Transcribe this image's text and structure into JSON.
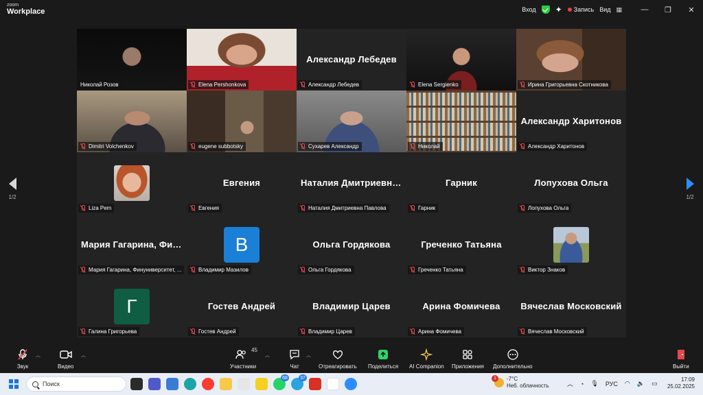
{
  "app": {
    "logo_top": "zoom",
    "logo_bottom": "Workplace"
  },
  "titlebar": {
    "enter": "Вход",
    "record": "Запись",
    "view": "Вид"
  },
  "colors": {
    "active_speaker": "#2ed36a",
    "accent": "#2d8cff",
    "muted": "#e5484d",
    "tile_bg": "#232323"
  },
  "gallery": {
    "page_indicator": "1/2",
    "tiles": [
      {
        "name": "Николай Розов",
        "kind": "video",
        "active": true,
        "muted": false,
        "scene": "dark"
      },
      {
        "name": "Elena Pershonkova",
        "kind": "video",
        "muted": true,
        "scene": "woman"
      },
      {
        "name": "Александр Лебедев",
        "display": "Александр Лебедев",
        "kind": "name",
        "muted": true
      },
      {
        "name": "Elena Sergienko",
        "kind": "video",
        "muted": true,
        "scene": "woman-dark"
      },
      {
        "name": "Ирина Григорьевна Скотникова",
        "kind": "video",
        "muted": true,
        "scene": "woman-room"
      },
      {
        "name": "Dimitri Volchenkov",
        "kind": "video",
        "muted": true,
        "scene": "man-headphones"
      },
      {
        "name": "eugene subbotsky",
        "kind": "video",
        "muted": true,
        "scene": "room-small"
      },
      {
        "name": "Сухарев Александр",
        "kind": "video",
        "muted": true,
        "scene": "man-bald"
      },
      {
        "name": "Николай",
        "kind": "video",
        "muted": true,
        "scene": "bookshelf"
      },
      {
        "name": "Александр Харитонов",
        "display": "Александр Харитонов",
        "kind": "name",
        "muted": true
      },
      {
        "name": "Liza Pem",
        "kind": "photo",
        "muted": true,
        "scene": "portrait-woman"
      },
      {
        "name": "Евгения",
        "display": "Евгения",
        "kind": "name",
        "muted": true
      },
      {
        "name": "Наталия Дмитриевна Павлова",
        "display": "Наталия Дмитриевна Павлова",
        "kind": "name",
        "muted": true
      },
      {
        "name": "Гарник",
        "display": "Гарник",
        "kind": "name",
        "muted": true
      },
      {
        "name": "Лопухова Ольга",
        "display": "Лопухова Ольга",
        "kind": "name",
        "muted": true
      },
      {
        "name": "Мария Гагарина, Финуниверситет, ...",
        "display": "Мария Гагарина, Финуниверситет",
        "kind": "name",
        "muted": true
      },
      {
        "name": "Владимир Мазилов",
        "kind": "letter",
        "letter": "В",
        "letter_color": "#1a7fd6",
        "muted": true
      },
      {
        "name": "Ольга Гордякова",
        "display": "Ольга Гордякова",
        "kind": "name",
        "muted": true
      },
      {
        "name": "Греченко Татьяна",
        "display": "Греченко Татьяна",
        "kind": "name",
        "muted": true
      },
      {
        "name": "Виктор Знаков",
        "kind": "photo",
        "muted": true,
        "scene": "portrait-outdoor"
      },
      {
        "name": "Галина Григорьева",
        "kind": "letter",
        "letter": "Г",
        "letter_color": "#0f5e43",
        "muted": true
      },
      {
        "name": "Гостев Андрей",
        "display": "Гостев Андрей",
        "kind": "name",
        "muted": true
      },
      {
        "name": "Владимир Царев",
        "display": "Владимир Царев",
        "kind": "name",
        "muted": true
      },
      {
        "name": "Арина Фомичева",
        "display": "Арина Фомичева",
        "kind": "name",
        "muted": true
      },
      {
        "name": "Вячеслав Московский",
        "display": "Вячеслав Московский",
        "kind": "name",
        "muted": true
      }
    ]
  },
  "toolbar": {
    "audio": "Звук",
    "video": "Видео",
    "participants": "Участники",
    "participants_count": "45",
    "chat": "Чат",
    "react": "Отреагировать",
    "share": "Поделиться",
    "ai": "AI Companion",
    "apps": "Приложения",
    "more": "Дополнительно",
    "leave": "Выйти"
  },
  "taskbar": {
    "search_placeholder": "Поиск",
    "badge_whatsapp": "68",
    "badge_telegram": "37",
    "weather_temp": "-7°C",
    "weather_desc": "Неб. облачность",
    "weather_badge": "1",
    "lang": "РУС",
    "time": "17:09",
    "date": "25.02.2025"
  }
}
